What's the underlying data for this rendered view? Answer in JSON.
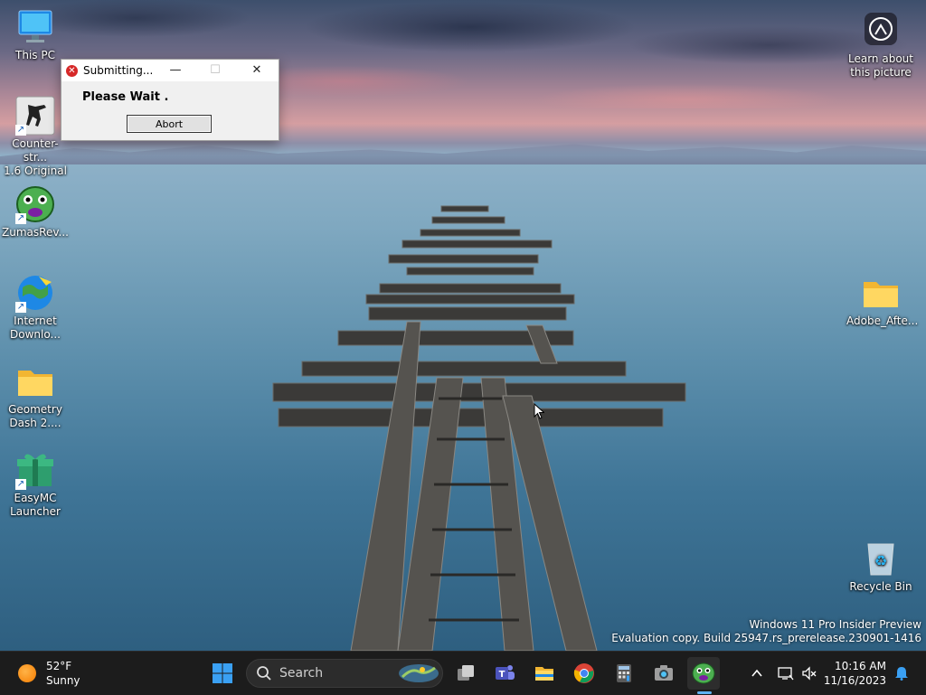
{
  "desktop": {
    "icons_left": [
      {
        "label": "This PC"
      },
      {
        "label": "Counter-str...\n1.6 Original"
      },
      {
        "label": "ZumasRev..."
      },
      {
        "label": "Internet\nDownlo..."
      },
      {
        "label": "Geometry\nDash 2...."
      },
      {
        "label": "EasyMC\nLauncher"
      }
    ],
    "icons_right": [
      {
        "label": "Learn about\nthis picture"
      },
      {
        "label": "Adobe_Afte..."
      },
      {
        "label": "Recycle Bin"
      }
    ]
  },
  "dialog": {
    "title": "Submitting...",
    "message": "Please Wait .",
    "abort_label": "Abort",
    "minimize": "—",
    "maximize": "☐",
    "close": "✕"
  },
  "watermark": {
    "line1": "Windows 11 Pro Insider Preview",
    "line2": "Evaluation copy. Build 25947.rs_prerelease.230901-1416"
  },
  "taskbar": {
    "weather_temp": "52°F",
    "weather_desc": "Sunny",
    "search_label": "Search",
    "apps": [
      "start-icon",
      "task-view-icon",
      "teams-icon",
      "file-explorer-icon",
      "chrome-icon",
      "calculator-icon",
      "camera-icon",
      "zuma-icon"
    ],
    "time": "10:16 AM",
    "date": "11/16/2023"
  },
  "colors": {
    "taskbar_bg": "#1c1c1c",
    "accent": "#5fb2f2",
    "dialog_bg": "#f0f0f0",
    "error_red": "#d62828"
  }
}
